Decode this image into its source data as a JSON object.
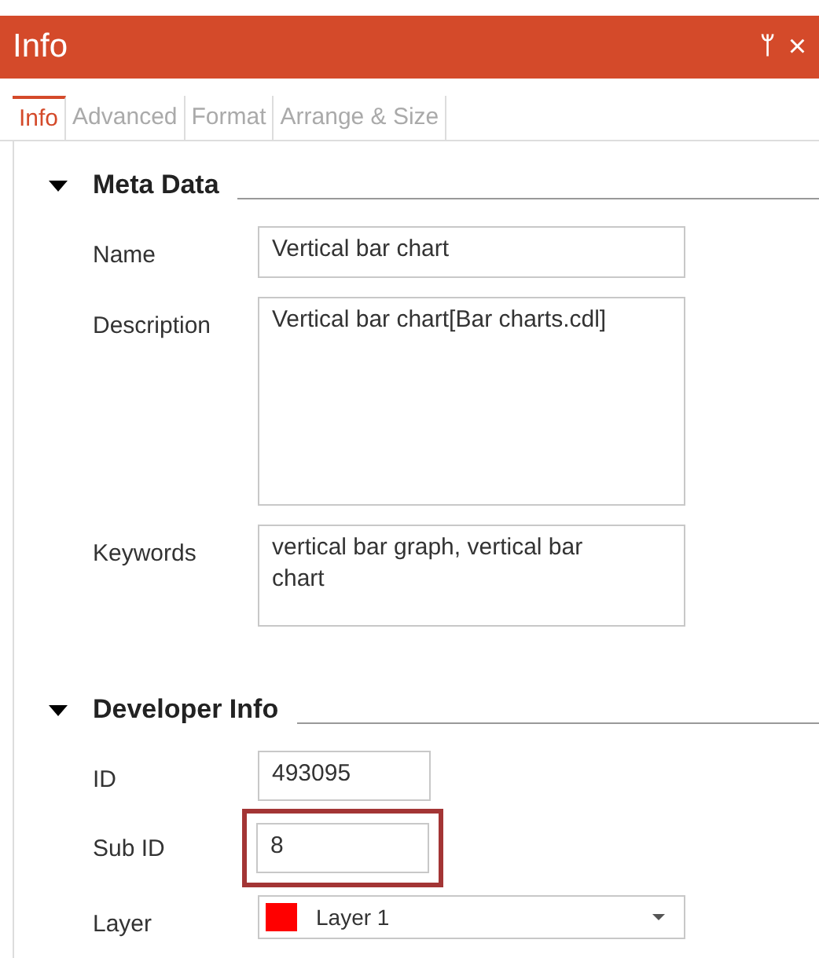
{
  "window": {
    "title": "Info",
    "pin_icon": "ᛘ",
    "close_icon": "×"
  },
  "tabs": [
    {
      "label": "Info",
      "selected": true
    },
    {
      "label": "Advanced",
      "selected": false
    },
    {
      "label": "Format",
      "selected": false
    },
    {
      "label": "Arrange & Size",
      "selected": false
    }
  ],
  "sections": [
    {
      "title": "Meta Data",
      "expanded": true,
      "fields": [
        {
          "kind": "text",
          "label": "Name",
          "value": "Vertical bar chart",
          "highlighted": false
        },
        {
          "kind": "text",
          "label": "Description",
          "value": "Vertical bar chart[Bar charts.cdl]",
          "highlighted": false
        },
        {
          "kind": "text",
          "label": "Keywords",
          "value": "vertical bar graph, vertical bar chart",
          "highlighted": false
        }
      ]
    },
    {
      "title": "Developer Info",
      "expanded": true,
      "fields": [
        {
          "kind": "text",
          "label": "ID",
          "value": "493095",
          "highlighted": false
        },
        {
          "kind": "text",
          "label": "Sub ID",
          "value": "8",
          "highlighted": true
        },
        {
          "kind": "dropdown",
          "label": "Layer",
          "value": "Layer 1",
          "color": "#ff0000",
          "highlighted": false
        }
      ]
    }
  ]
}
